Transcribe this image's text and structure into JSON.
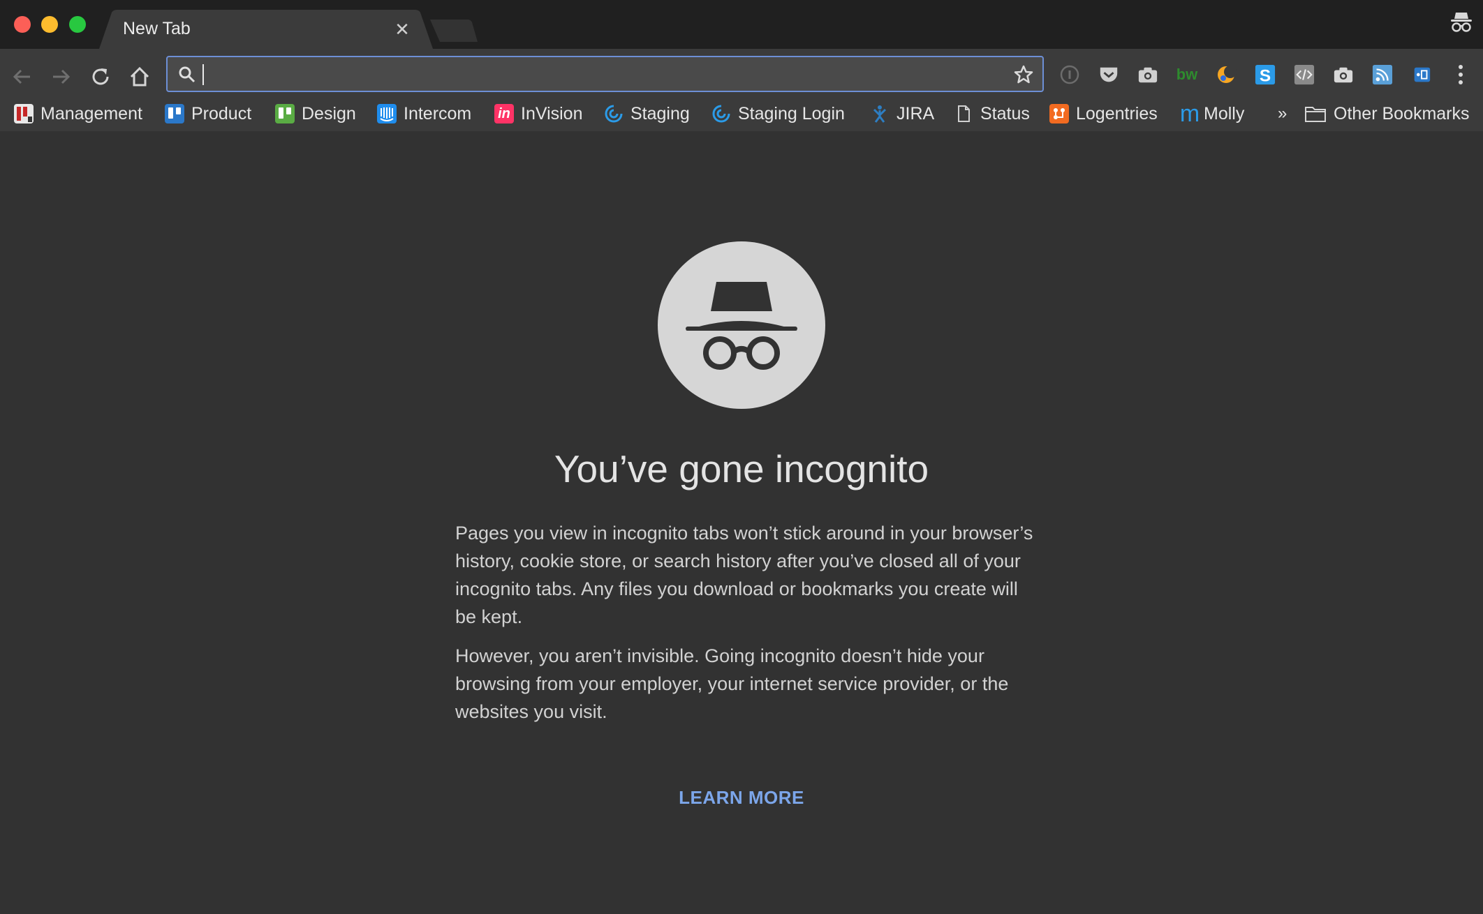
{
  "tab": {
    "title": "New Tab"
  },
  "omnibox": {
    "value": "",
    "placeholder": ""
  },
  "bookmarks": {
    "items": [
      {
        "label": "Management",
        "icon": "management-icon",
        "color": "#e8e8e8"
      },
      {
        "label": "Product",
        "icon": "trello-icon",
        "color": "#2b78c9"
      },
      {
        "label": "Design",
        "icon": "trello-icon",
        "color": "#5aac44"
      },
      {
        "label": "Intercom",
        "icon": "intercom-icon",
        "color": "#1f8ded"
      },
      {
        "label": "InVision",
        "icon": "invision-icon",
        "color": "#ff3366"
      },
      {
        "label": "Staging",
        "icon": "staging-icon",
        "color": "#2b9be8"
      },
      {
        "label": "Staging Login",
        "icon": "staging-icon",
        "color": "#2b9be8"
      },
      {
        "label": "JIRA",
        "icon": "jira-icon",
        "color": "#2d7ec3"
      },
      {
        "label": "Status",
        "icon": "page-icon",
        "color": "#cccccc"
      },
      {
        "label": "Logentries",
        "icon": "logentries-icon",
        "color": "#f26b21"
      },
      {
        "label": "Molly",
        "icon": "molly-icon",
        "color": "#2b9be8"
      }
    ],
    "overflow": "»",
    "other": "Other Bookmarks"
  },
  "content": {
    "headline": "You’ve gone incognito",
    "paragraph1": "Pages you view in incognito tabs won’t stick around in your browser’s history, cookie store, or search history after you’ve closed all of your incognito tabs. Any files you download or bookmarks you create will be kept.",
    "paragraph2": "However, you aren’t invisible. Going incognito doesn’t hide your browsing from your employer, your internet service provider, or the websites you visit.",
    "learn_more": "LEARN MORE"
  },
  "colors": {
    "accent": "#7ca6ea",
    "background": "#323232",
    "toolbar": "#3b3b3b"
  }
}
